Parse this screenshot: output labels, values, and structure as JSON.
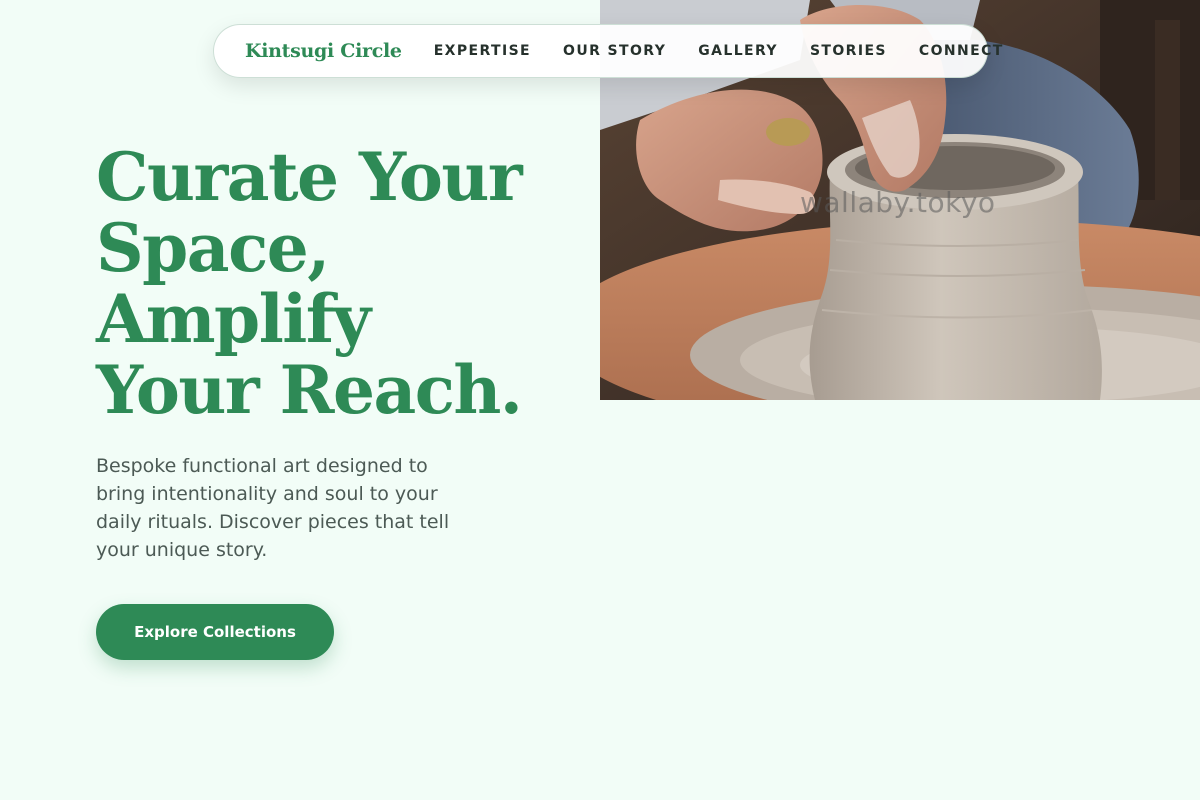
{
  "nav": {
    "brand": "Kintsugi Circle",
    "links": [
      "EXPERTISE",
      "OUR STORY",
      "GALLERY",
      "STORIES",
      "CONNECT"
    ]
  },
  "hero": {
    "headline_lines": [
      "Curate Your",
      "Space,",
      "Amplify",
      "Your Reach."
    ],
    "subtext": "Bespoke functional art designed to bring intentionality and soul to your daily rituals. Discover pieces that tell your unique story.",
    "cta_label": "Explore Collections",
    "image_watermark": "wallaby.tokyo"
  },
  "colors": {
    "background": "#f2fdf7",
    "accent_green": "#2e8a56",
    "nav_text": "#26312c",
    "body_text": "#4c5a55"
  }
}
